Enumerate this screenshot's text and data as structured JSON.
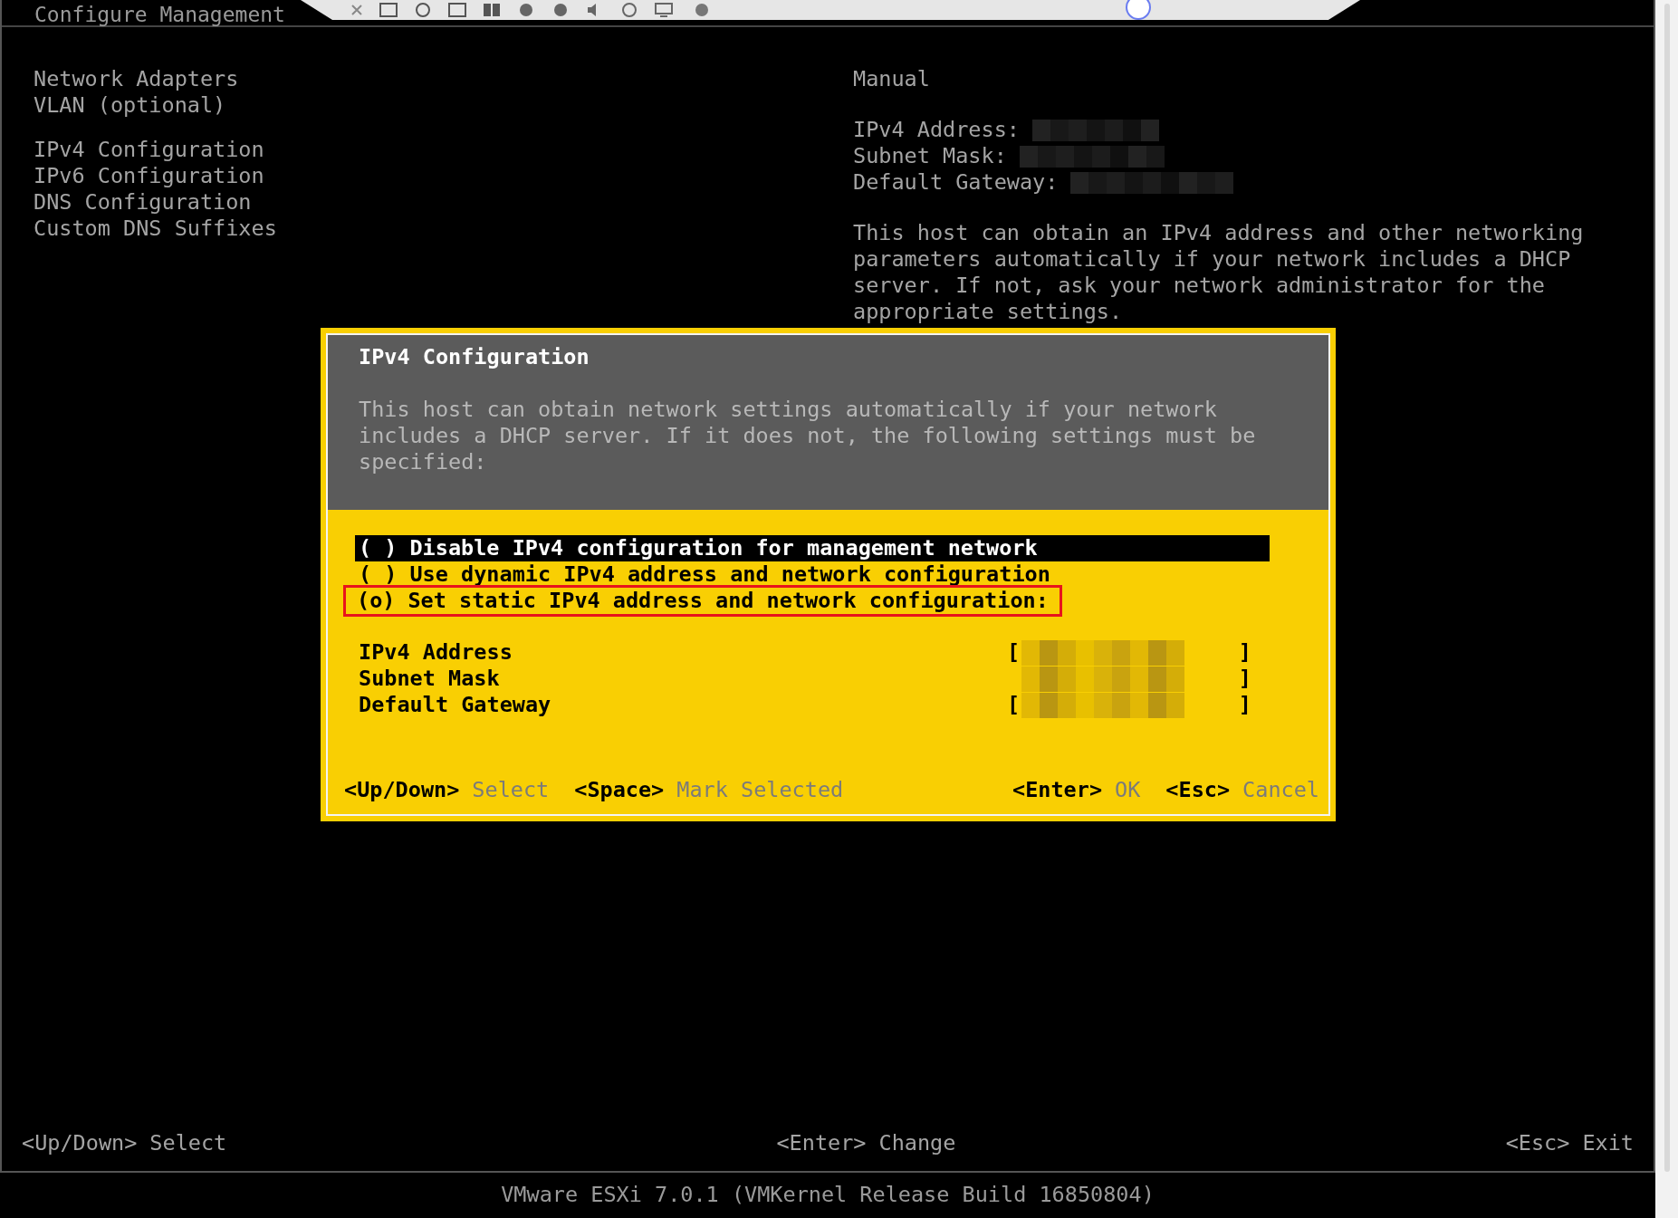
{
  "screen_title": "Configure Management",
  "menu_groups": [
    {
      "items": [
        "Network Adapters",
        "VLAN (optional)"
      ]
    },
    {
      "items": [
        "IPv4 Configuration",
        "IPv6 Configuration",
        "DNS Configuration",
        "Custom DNS Suffixes"
      ]
    }
  ],
  "details": {
    "mode": "Manual",
    "fields": [
      {
        "label": "IPv4 Address:",
        "value_redacted": true
      },
      {
        "label": "Subnet Mask:",
        "value_redacted": true
      },
      {
        "label": "Default Gateway:",
        "value_redacted": true
      }
    ],
    "description": "This host can obtain an IPv4 address and other networking parameters automatically if your network includes a DHCP server. If not, ask your network administrator for the appropriate settings."
  },
  "dialog": {
    "title": "IPv4 Configuration",
    "description": "This host can obtain network settings automatically if your network includes a DHCP server. If it does not, the following settings must be specified:",
    "options": [
      {
        "marker": "( )",
        "label": "Disable IPv4 configuration for management network",
        "focused": true,
        "annotated": false
      },
      {
        "marker": "( )",
        "label": "Use dynamic IPv4 address and network configuration",
        "focused": false,
        "annotated": false
      },
      {
        "marker": "(o)",
        "label": "Set static IPv4 address and network configuration:",
        "focused": false,
        "annotated": true
      }
    ],
    "fields": [
      {
        "label": "IPv4 Address",
        "open": "[",
        "close": "]",
        "value_redacted": true
      },
      {
        "label": "Subnet Mask",
        "close": "]",
        "value_redacted": true
      },
      {
        "label": "Default Gateway",
        "open": "[",
        "close": "]",
        "value_redacted": true
      }
    ],
    "footer_left": [
      {
        "key": "<Up/Down>",
        "action": "Select"
      },
      {
        "key": "<Space>",
        "action": "Mark Selected"
      }
    ],
    "footer_right": [
      {
        "key": "<Enter>",
        "action": "OK"
      },
      {
        "key": "<Esc>",
        "action": "Cancel"
      }
    ]
  },
  "bottom_nav": [
    {
      "key": "<Up/Down>",
      "action": "Select"
    },
    {
      "key": "<Enter>",
      "action": "Change"
    },
    {
      "key": "<Esc>",
      "action": "Exit"
    }
  ],
  "status_bar": "VMware ESXi 7.0.1 (VMKernel Release Build 16850804)"
}
